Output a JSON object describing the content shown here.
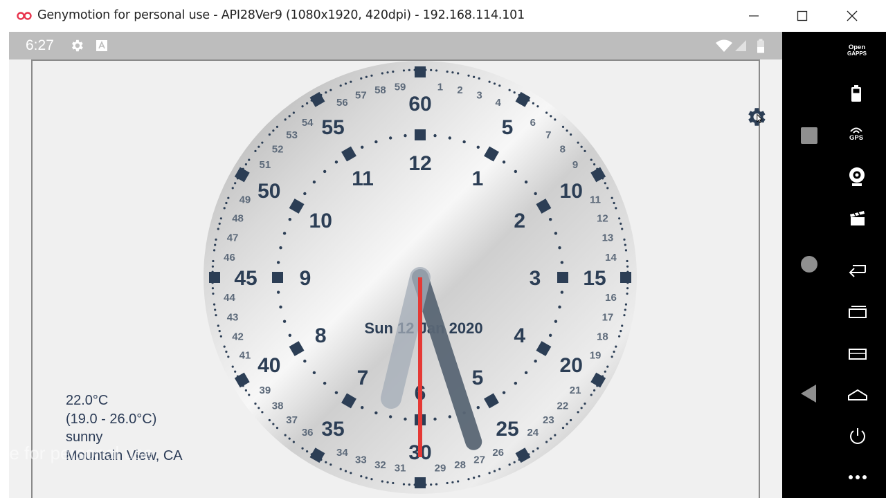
{
  "window": {
    "title": "Genymotion for personal use - API28Ver9 (1080x1920, 420dpi) - 192.168.114.101",
    "minimize_label": "–",
    "maximize_label": "☐",
    "close_label": "✕"
  },
  "statusbar": {
    "time": "6:27"
  },
  "clock": {
    "date_text": "Sun 12 Jan 2020",
    "hour_numbers": [
      "12",
      "1",
      "2",
      "3",
      "4",
      "5",
      "6",
      "7",
      "8",
      "9",
      "10",
      "11"
    ],
    "major_minute_numbers": [
      "60",
      "5",
      "10",
      "15",
      "20",
      "25",
      "30",
      "35",
      "40",
      "45",
      "50",
      "55"
    ],
    "minor_minute_numbers": [
      "1",
      "2",
      "3",
      "4",
      "6",
      "7",
      "8",
      "9",
      "11",
      "12",
      "13",
      "14",
      "16",
      "17",
      "18",
      "19",
      "21",
      "22",
      "23",
      "24",
      "26",
      "27",
      "28",
      "29",
      "31",
      "32",
      "33",
      "34",
      "36",
      "37",
      "38",
      "39",
      "41",
      "42",
      "43",
      "44",
      "46",
      "47",
      "48",
      "49",
      "51",
      "52",
      "53",
      "54",
      "56",
      "57",
      "58",
      "59"
    ],
    "hour_value": 6.45,
    "minute_value": 27,
    "second_value": 30
  },
  "weather": {
    "temperature": "22.0°C",
    "range": "(19.0 - 26.0°C)",
    "condition": "sunny",
    "location": "Mountain View, CA"
  },
  "watermark": "free for personal use",
  "sidebar": {
    "opengapps_line1": "Open",
    "opengapps_line2": "GAPPS",
    "gps_label": "GPS"
  },
  "colors": {
    "clock_ink": "#2c3e55",
    "second_hand": "#e53935",
    "status_bar": "#bdbdbd",
    "sidebar_bg": "#000000"
  }
}
